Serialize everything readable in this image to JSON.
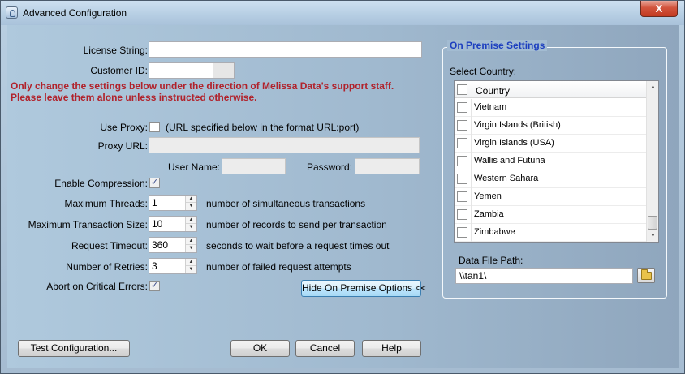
{
  "window": {
    "title": "Advanced Configuration",
    "close_glyph": "X"
  },
  "form": {
    "license_label": "License String:",
    "license_value": "",
    "customer_label": "Customer ID:",
    "customer_value": "",
    "warning_line1": "Only change the settings below under the direction of Melissa Data's support staff.",
    "warning_line2": "Please leave them alone unless instructed otherwise.",
    "use_proxy_label": "Use Proxy:",
    "use_proxy_checked": false,
    "use_proxy_hint": "(URL specified below in the format URL:port)",
    "proxy_url_label": "Proxy URL:",
    "proxy_url_value": "",
    "username_label": "User Name:",
    "username_value": "",
    "password_label": "Password:",
    "password_value": "",
    "compression_label": "Enable Compression:",
    "compression_checked": true,
    "threads_label": "Maximum Threads:",
    "threads_value": "1",
    "threads_hint": "number of simultaneous transactions",
    "txsize_label": "Maximum Transaction Size:",
    "txsize_value": "10",
    "txsize_hint": "number of records to send per transaction",
    "timeout_label": "Request Timeout:",
    "timeout_value": "360",
    "timeout_hint": "seconds to wait before a request times out",
    "retries_label": "Number of Retries:",
    "retries_value": "3",
    "retries_hint": "number of failed request attempts",
    "abort_label": "Abort on Critical Errors:",
    "abort_checked": true,
    "check_glyph": "✓"
  },
  "onprem": {
    "group_title": "On Premise Settings",
    "select_country_label": "Select Country:",
    "column_header": "Country",
    "countries": [
      {
        "name": "Vietnam",
        "checked": false
      },
      {
        "name": "Virgin Islands (British)",
        "checked": false
      },
      {
        "name": "Virgin Islands (USA)",
        "checked": false
      },
      {
        "name": "Wallis and Futuna",
        "checked": false
      },
      {
        "name": "Western Sahara",
        "checked": false
      },
      {
        "name": "Yemen",
        "checked": false
      },
      {
        "name": "Zambia",
        "checked": false
      },
      {
        "name": "Zimbabwe",
        "checked": false
      }
    ],
    "scroll_up_glyph": "▲",
    "scroll_down_glyph": "▼",
    "data_path_label": "Data File Path:",
    "data_path_value": "\\\\tan1\\",
    "folder_icon": "folder-open-icon"
  },
  "buttons": {
    "hide_onprem": "Hide On Premise Options <<",
    "test": "Test Configuration...",
    "ok": "OK",
    "cancel": "Cancel",
    "help": "Help"
  },
  "colors": {
    "warning": "#b1222b",
    "group_title": "#1d3fbf",
    "close_button": "#c23a20"
  }
}
